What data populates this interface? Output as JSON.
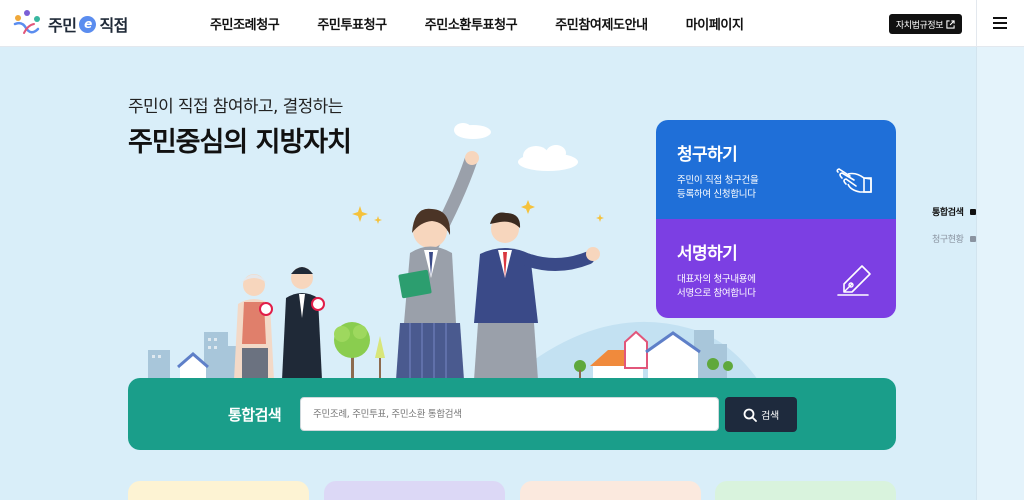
{
  "header": {
    "logo_text_left": "주민",
    "logo_badge": "e",
    "logo_text_right": "직접",
    "nav": [
      "주민조례청구",
      "주민투표청구",
      "주민소환투표청구",
      "주민참여제도안내",
      "마이페이지"
    ],
    "ext_button_label": "자치법규정보",
    "ext_button_icon": "external-link-icon",
    "menu_icon": "hamburger-menu-icon"
  },
  "hero": {
    "subtitle": "주민이 직접 참여하고, 결정하는",
    "title": "주민중심의 지방자치"
  },
  "cards": [
    {
      "title": "청구하기",
      "desc_line1": "주민이 직접 청구건을",
      "desc_line2": "등록하여 신청합니다",
      "icon": "hand-pointing-icon",
      "color": "#1f6fd8"
    },
    {
      "title": "서명하기",
      "desc_line1": "대표자의 청구내용에",
      "desc_line2": "서명으로 참여합니다",
      "icon": "pen-nib-icon",
      "color": "#7c3fe3"
    }
  ],
  "side_nav": [
    {
      "label": "통합검색",
      "active": true
    },
    {
      "label": "청구현황",
      "active": false
    }
  ],
  "search": {
    "label": "통합검색",
    "placeholder": "주민조례, 주민투표, 주민소환 통합검색",
    "value": "",
    "button_label": "검색",
    "button_icon": "search-icon",
    "band_color": "#1a9e8a"
  },
  "colors": {
    "background": "#d9eef9",
    "peek_cards": [
      "#fdf3d3",
      "#dcd8f6",
      "#fbe9de",
      "#d9f3dd"
    ]
  }
}
